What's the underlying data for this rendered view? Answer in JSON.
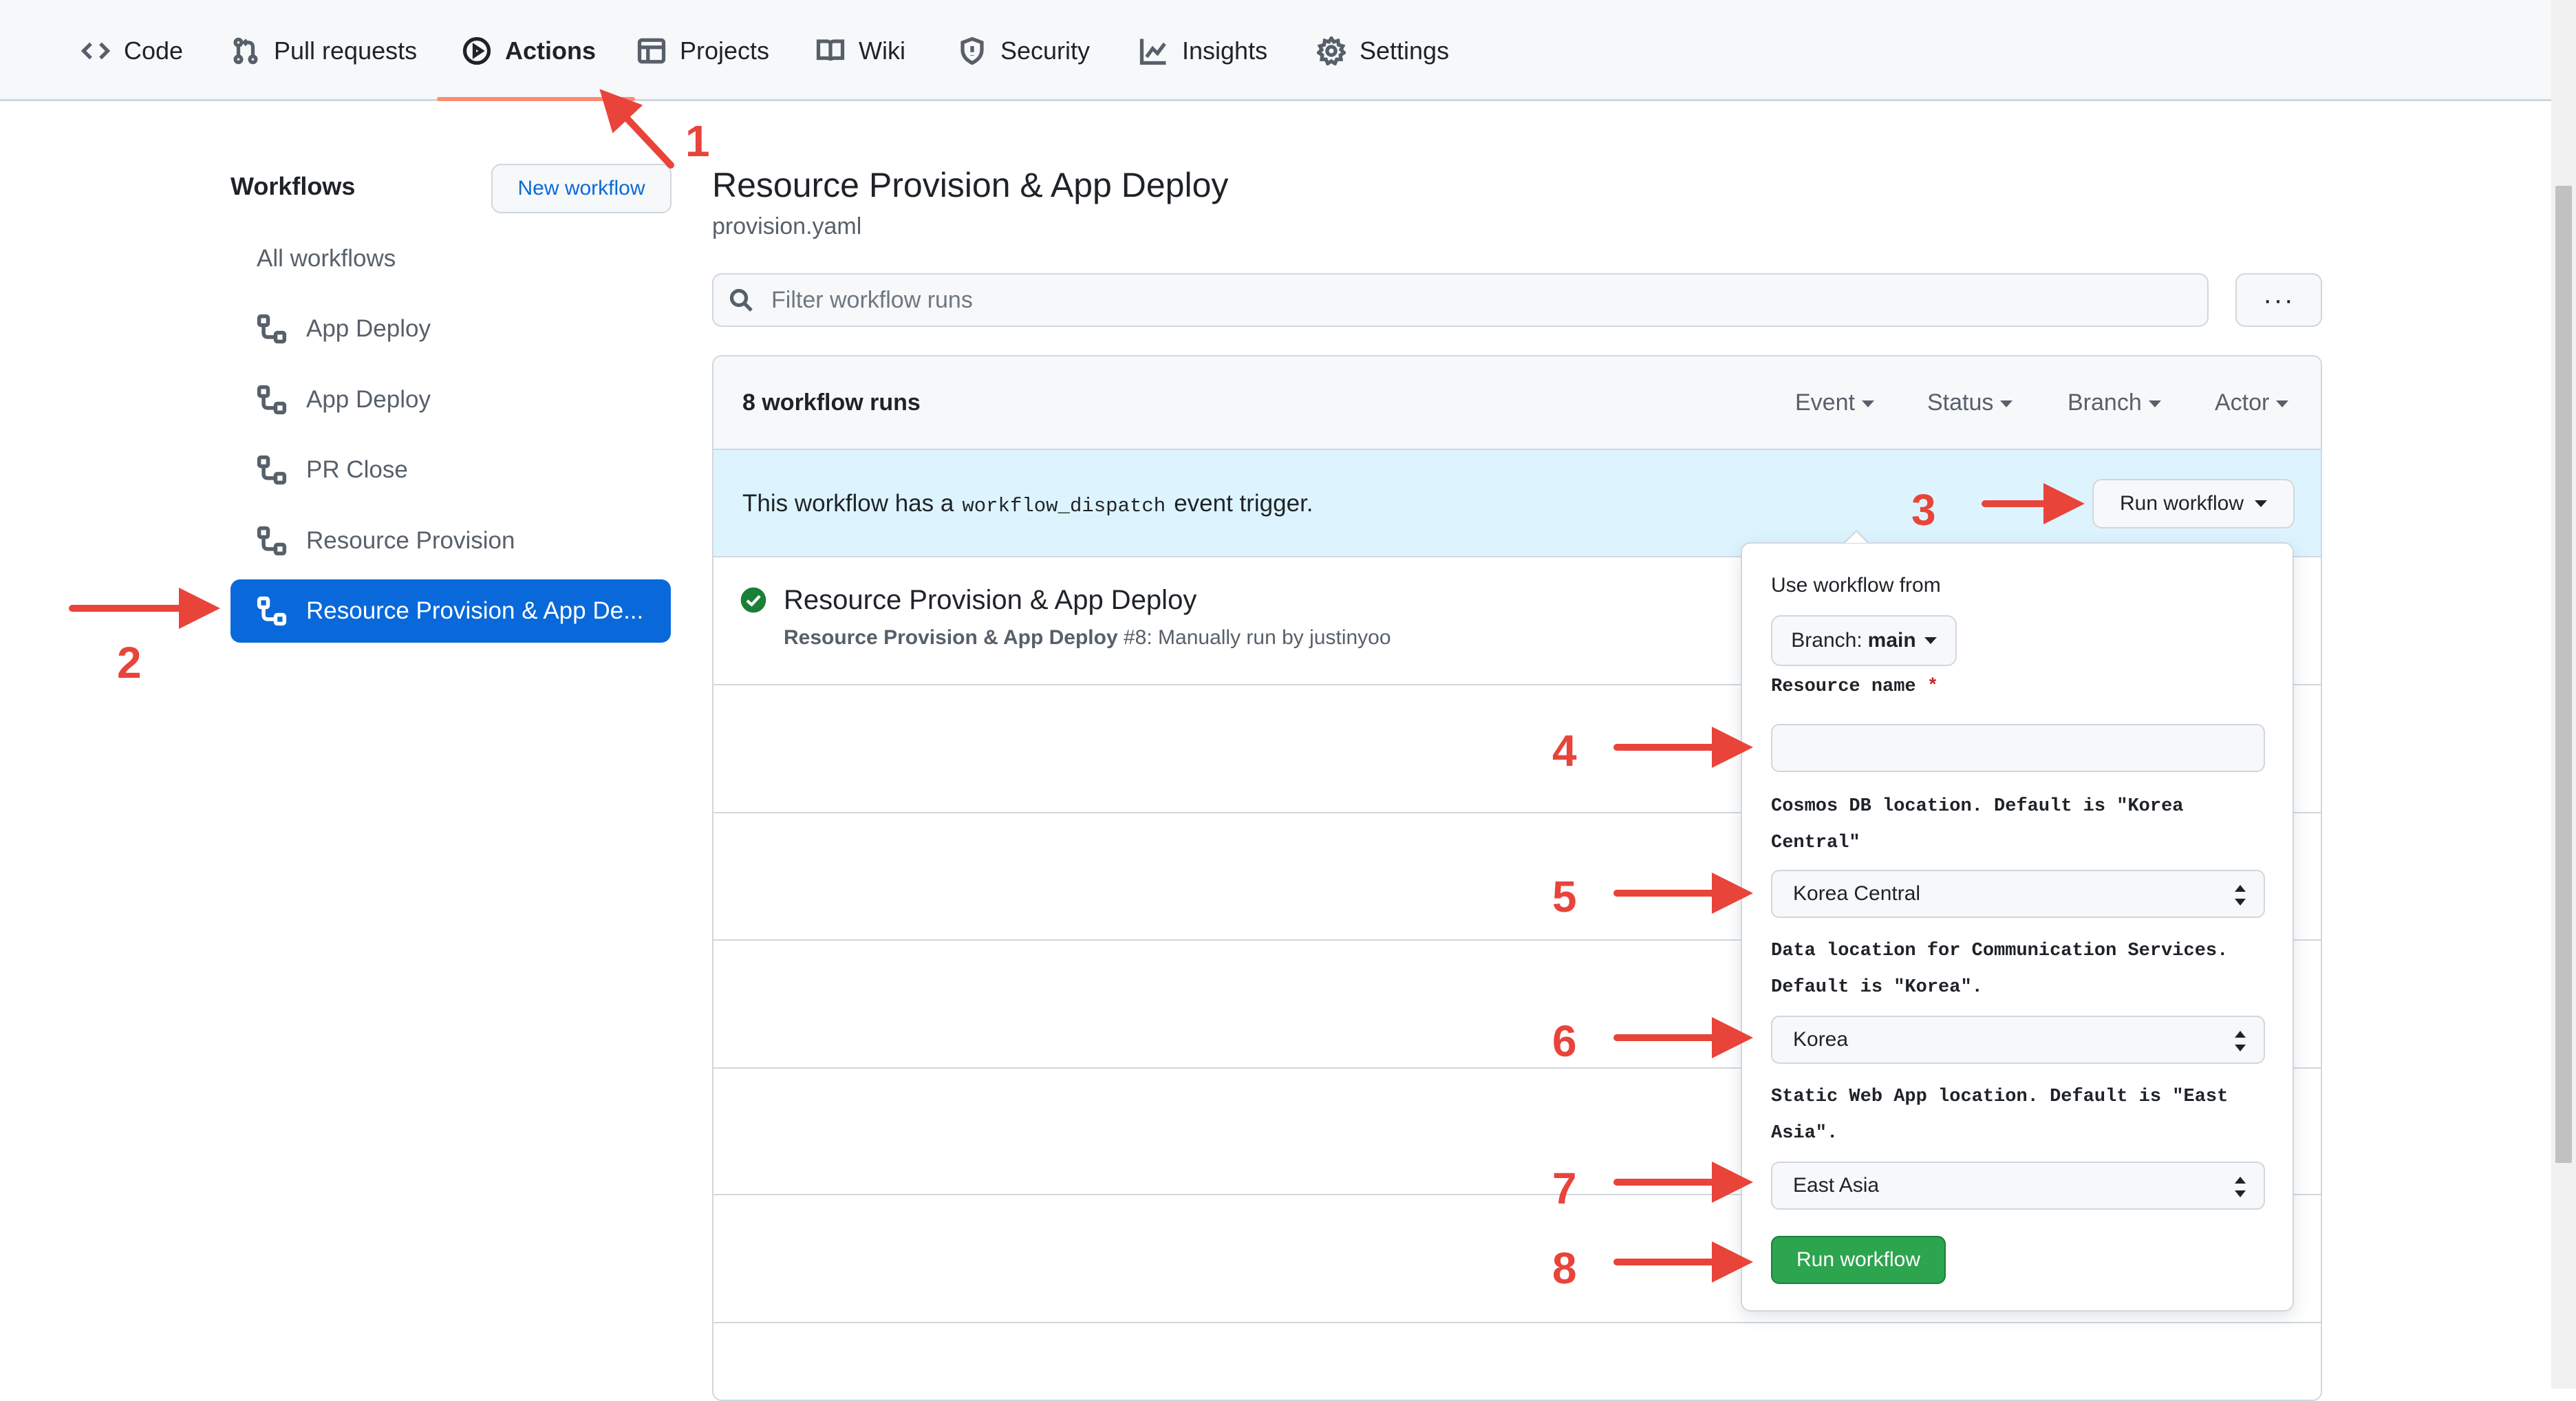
{
  "nav": {
    "tabs": [
      {
        "label": "Code",
        "icon": "code-icon"
      },
      {
        "label": "Pull requests",
        "icon": "git-pull-request-icon"
      },
      {
        "label": "Actions",
        "icon": "play-icon",
        "active": true
      },
      {
        "label": "Projects",
        "icon": "table-icon"
      },
      {
        "label": "Wiki",
        "icon": "book-icon"
      },
      {
        "label": "Security",
        "icon": "shield-icon"
      },
      {
        "label": "Insights",
        "icon": "graph-icon"
      },
      {
        "label": "Settings",
        "icon": "gear-icon"
      }
    ]
  },
  "sidebar": {
    "title": "Workflows",
    "new_workflow_label": "New workflow",
    "all_label": "All workflows",
    "items": [
      {
        "label": "App Deploy"
      },
      {
        "label": "App Deploy"
      },
      {
        "label": "PR Close"
      },
      {
        "label": "Resource Provision"
      },
      {
        "label": "Resource Provision & App De...",
        "selected": true
      }
    ]
  },
  "main": {
    "title": "Resource Provision & App Deploy",
    "subtitle": "provision.yaml",
    "filter_placeholder": "Filter workflow runs",
    "more_label": "···",
    "runs_count": "8 workflow runs",
    "filters": [
      "Event",
      "Status",
      "Branch",
      "Actor"
    ],
    "dispatch": {
      "text_before": "This workflow has a",
      "code": "workflow_dispatch",
      "text_after": "event trigger.",
      "button_label": "Run workflow"
    },
    "runs": [
      {
        "title": "Resource Provision & App Deploy",
        "workflow_name": "Resource Provision & App Deploy",
        "meta": "#8: Manually run by justinyoo",
        "status": "success"
      }
    ]
  },
  "dispatch_panel": {
    "use_from_label": "Use workflow from",
    "branch_prefix": "Branch:",
    "branch_value": "main",
    "resource_name_label": "Resource name",
    "required_mark": "*",
    "resource_name_value": "",
    "cosmos_label": "Cosmos DB location. Default is \"Korea Central\"",
    "cosmos_value": "Korea Central",
    "comm_label": "Data location for Communication Services. Default is \"Korea\".",
    "comm_value": "Korea",
    "swa_label": "Static Web App location. Default is \"East Asia\".",
    "swa_value": "East Asia",
    "submit_label": "Run workflow"
  },
  "annotations": [
    "1",
    "2",
    "3",
    "4",
    "5",
    "6",
    "7",
    "8"
  ],
  "colors": {
    "accent_blue": "#0969da",
    "success_green": "#2da44e",
    "annotation_red": "#e8443a",
    "active_tab_underline": "#fd8c73",
    "dispatch_bar_bg": "#ddf4ff"
  }
}
